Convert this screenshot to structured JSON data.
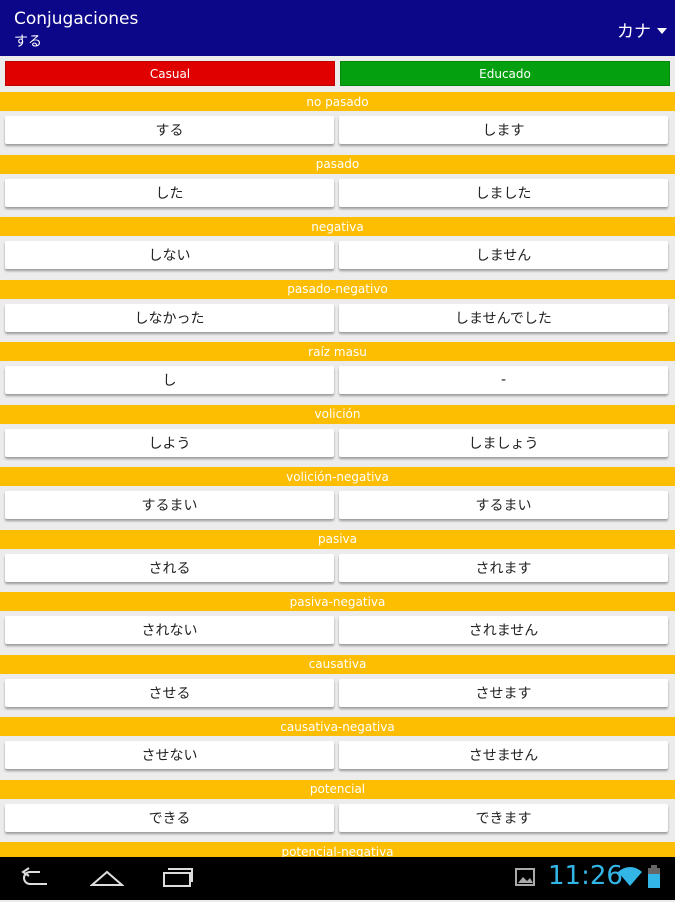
{
  "app": {
    "title": "Conjugaciones",
    "subtitle": "する",
    "mode": "カナ"
  },
  "tabs": {
    "casual": "Casual",
    "polite": "Educado"
  },
  "colors": {
    "appbar": "#0c0689",
    "casual": "#e00000",
    "polite": "#05a00f",
    "header": "#fdbd00",
    "clock": "#33b5e5"
  },
  "rows": [
    {
      "label": "no pasado",
      "casual": "する",
      "polite": "します"
    },
    {
      "label": "pasado",
      "casual": "した",
      "polite": "しました"
    },
    {
      "label": "negativa",
      "casual": "しない",
      "polite": "しません"
    },
    {
      "label": "pasado-negativo",
      "casual": "しなかった",
      "polite": "しませんでした"
    },
    {
      "label": "raíz masu",
      "casual": "し",
      "polite": "-"
    },
    {
      "label": "volición",
      "casual": "しよう",
      "polite": "しましょう"
    },
    {
      "label": "volición-negativa",
      "casual": "するまい",
      "polite": "するまい"
    },
    {
      "label": "pasiva",
      "casual": "される",
      "polite": "されます"
    },
    {
      "label": "pasiva-negativa",
      "casual": "されない",
      "polite": "されません"
    },
    {
      "label": "causativa",
      "casual": "させる",
      "polite": "させます"
    },
    {
      "label": "causativa-negativa",
      "casual": "させない",
      "polite": "させません"
    },
    {
      "label": "potencial",
      "casual": "できる",
      "polite": "できます"
    },
    {
      "label": "potencial-negativa",
      "casual": "",
      "polite": ""
    }
  ],
  "status": {
    "clock": "11:26"
  },
  "icons": {
    "back": "back-icon",
    "home": "home-icon",
    "recent": "recent-apps-icon",
    "gallery": "gallery-icon",
    "wifi": "wifi-icon",
    "battery": "battery-icon"
  }
}
